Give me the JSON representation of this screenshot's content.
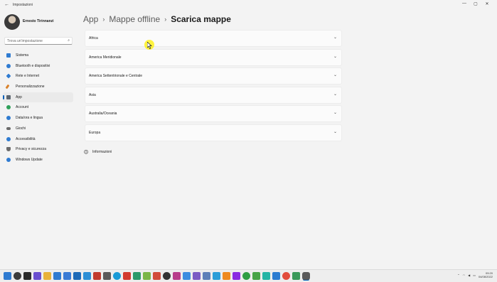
{
  "window": {
    "title": "Impostazioni",
    "controls": [
      "—",
      "▢",
      "✕"
    ]
  },
  "user": {
    "name": "Ernesto Tirinnanzi"
  },
  "search": {
    "placeholder": "Trova un'impostazione"
  },
  "sidebar": {
    "items": [
      {
        "label": "Sistema",
        "icon": "monitor-icon",
        "color": "#2f7bd1",
        "active": false
      },
      {
        "label": "Bluetooth e dispositivi",
        "icon": "bluetooth-icon",
        "color": "#2f7bd1",
        "active": false
      },
      {
        "label": "Rete e Internet",
        "icon": "network-icon",
        "color": "#2f7bd1",
        "active": false
      },
      {
        "label": "Personalizzazione",
        "icon": "brush-icon",
        "color": "#d9822b",
        "active": false
      },
      {
        "label": "App",
        "icon": "apps-icon",
        "color": "#5c6670",
        "active": true
      },
      {
        "label": "Account",
        "icon": "account-icon",
        "color": "#2fa15a",
        "active": false
      },
      {
        "label": "Data/ora e lingua",
        "icon": "globe-icon",
        "color": "#2f7bd1",
        "active": false
      },
      {
        "label": "Giochi",
        "icon": "controller-icon",
        "color": "#6b6b6b",
        "active": false
      },
      {
        "label": "Accessibilità",
        "icon": "accessibility-icon",
        "color": "#2f7bd1",
        "active": false
      },
      {
        "label": "Privacy e sicurezza",
        "icon": "shield-icon",
        "color": "#6b6b6b",
        "active": false
      },
      {
        "label": "Windows Update",
        "icon": "update-icon",
        "color": "#2f7bd1",
        "active": false
      }
    ]
  },
  "breadcrumb": {
    "items": [
      "App",
      "Mappe offline"
    ],
    "current": "Scarica mappe"
  },
  "regions": [
    "Africa",
    "America Meridionale",
    "America Settentrionale e Centrale",
    "Asia",
    "Australia/Oceania",
    "Europa"
  ],
  "info": {
    "label": "Informazioni"
  },
  "taskbar": {
    "time": "09:20",
    "date": "04/08/2022"
  },
  "colors": {
    "accent": "#005fb8",
    "cursor_highlight": "#fff000"
  }
}
